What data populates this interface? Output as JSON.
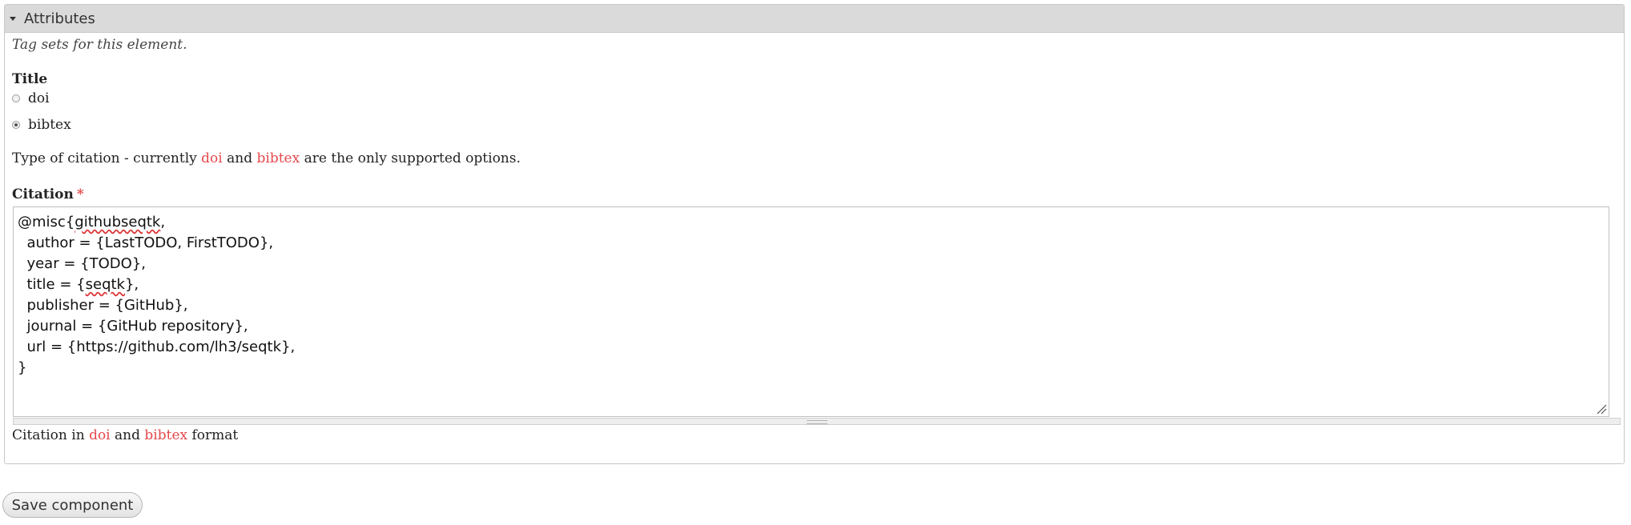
{
  "section": {
    "legend": "Attributes",
    "description": "Tag sets for this element."
  },
  "title_field": {
    "label": "Title",
    "options": [
      {
        "label": "doi",
        "checked": false
      },
      {
        "label": "bibtex",
        "checked": true
      }
    ],
    "help": {
      "part1": "Type of citation - currently ",
      "link1": "doi",
      "part2": " and ",
      "link2": "bibtex",
      "part3": " are the only supported options."
    }
  },
  "citation_field": {
    "label": "Citation",
    "required_marker": "*",
    "lines": [
      "@misc{githubseqtk,",
      "  author = {LastTODO, FirstTODO},",
      "  year = {TODO},",
      "  title = {seqtk},",
      "  publisher = {GitHub},",
      "  journal = {GitHub repository},",
      "  url = {https://github.com/lh3/seqtk},",
      "}"
    ],
    "help": {
      "part1": "Citation in ",
      "link1": "doi",
      "part2": " and ",
      "link2": "bibtex",
      "part3": " format"
    }
  },
  "actions": {
    "save_label": "Save component"
  },
  "colors": {
    "link": "#e5484d",
    "legend_bg": "#dadada"
  }
}
